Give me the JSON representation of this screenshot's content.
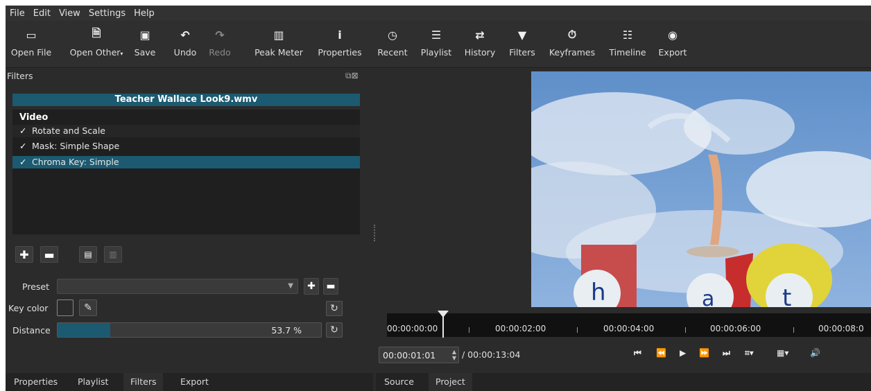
{
  "menu": [
    "File",
    "Edit",
    "View",
    "Settings",
    "Help"
  ],
  "toolbar": [
    {
      "label": "Open File",
      "icon": "folder-icon",
      "glyph": "▭"
    },
    {
      "label": "Open Other",
      "icon": "open-other-icon",
      "glyph": "🗎"
    },
    {
      "label": "Save",
      "icon": "save-icon",
      "glyph": "💾"
    },
    {
      "label": "Undo",
      "icon": "undo-icon",
      "glyph": "↶"
    },
    {
      "label": "Redo",
      "icon": "redo-icon",
      "glyph": "↷"
    },
    {
      "label": "Peak Meter",
      "icon": "peak-meter-icon",
      "glyph": "▥"
    },
    {
      "label": "Properties",
      "icon": "info-icon",
      "glyph": "ℹ"
    },
    {
      "label": "Recent",
      "icon": "clock-icon",
      "glyph": "◷"
    },
    {
      "label": "Playlist",
      "icon": "list-icon",
      "glyph": "☰"
    },
    {
      "label": "History",
      "icon": "history-icon",
      "glyph": "⇄"
    },
    {
      "label": "Filters",
      "icon": "funnel-icon",
      "glyph": "▼"
    },
    {
      "label": "Keyframes",
      "icon": "stopwatch-icon",
      "glyph": "⏱"
    },
    {
      "label": "Timeline",
      "icon": "timeline-icon",
      "glyph": "☷"
    },
    {
      "label": "Export",
      "icon": "export-icon",
      "glyph": "◉"
    }
  ],
  "panel": {
    "title": "Filters",
    "clip_name": "Teacher Wallace Look9.wmv",
    "list_header": "Video",
    "filters": [
      "Rotate and Scale",
      "Mask: Simple Shape",
      "Chroma Key: Simple"
    ],
    "selected_index": 2
  },
  "props": {
    "preset_label": "Preset",
    "key_color_label": "Key color",
    "distance_label": "Distance",
    "distance_value": "53.7 %",
    "distance_fraction": 0.537
  },
  "left_tabs": [
    "Properties",
    "Playlist",
    "Filters",
    "Export"
  ],
  "right_tabs": [
    "Source",
    "Project"
  ],
  "timeline": {
    "labels": [
      "00:00:00:00",
      "00:00:02:00",
      "00:00:04:00",
      "00:00:06:00",
      "00:00:08:0"
    ]
  },
  "timecode": {
    "current": "00:00:01:01",
    "total": "/ 00:00:13:04"
  },
  "colors": {
    "accent": "#1b5a70",
    "background": "#2b2b2b"
  }
}
